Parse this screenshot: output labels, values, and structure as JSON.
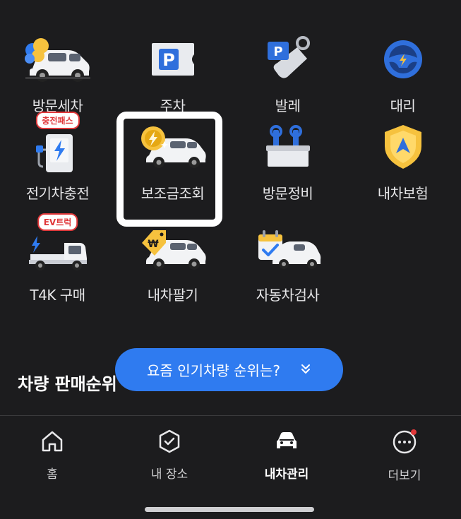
{
  "services": [
    {
      "label": "방문세차",
      "icon": "car-wash-icon"
    },
    {
      "label": "주차",
      "icon": "parking-ticket-icon"
    },
    {
      "label": "발레",
      "icon": "valet-tag-icon"
    },
    {
      "label": "대리",
      "icon": "steering-wheel-icon"
    },
    {
      "label": "전기차충전",
      "icon": "ev-charger-icon",
      "badge": "충전패스"
    },
    {
      "label": "보조금조회",
      "icon": "subsidy-coin-car-icon"
    },
    {
      "label": "방문정비",
      "icon": "toolbox-icon"
    },
    {
      "label": "내차보험",
      "icon": "insurance-shield-icon"
    },
    {
      "label": "T4K 구매",
      "icon": "electric-truck-icon",
      "badge": "EV트럭"
    },
    {
      "label": "내차팔기",
      "icon": "sell-car-tag-icon"
    },
    {
      "label": "자동차검사",
      "icon": "inspection-calendar-icon"
    }
  ],
  "section_title": "차량 판매순위",
  "popular_pill": {
    "label": "요즘 인기차량 순위는?",
    "icon": "double-chevron-down-icon"
  },
  "bottom_nav": [
    {
      "label": "홈",
      "icon": "home-icon",
      "active": false
    },
    {
      "label": "내 장소",
      "icon": "place-check-icon",
      "active": false
    },
    {
      "label": "내차관리",
      "icon": "car-front-icon",
      "active": true
    },
    {
      "label": "더보기",
      "icon": "more-dots-icon",
      "active": false,
      "notification_dot": true
    }
  ],
  "colors": {
    "background": "#1c1c1e",
    "accent": "#2f7bf0",
    "badge_red": "#e0383a",
    "highlight": "#ffffff"
  }
}
